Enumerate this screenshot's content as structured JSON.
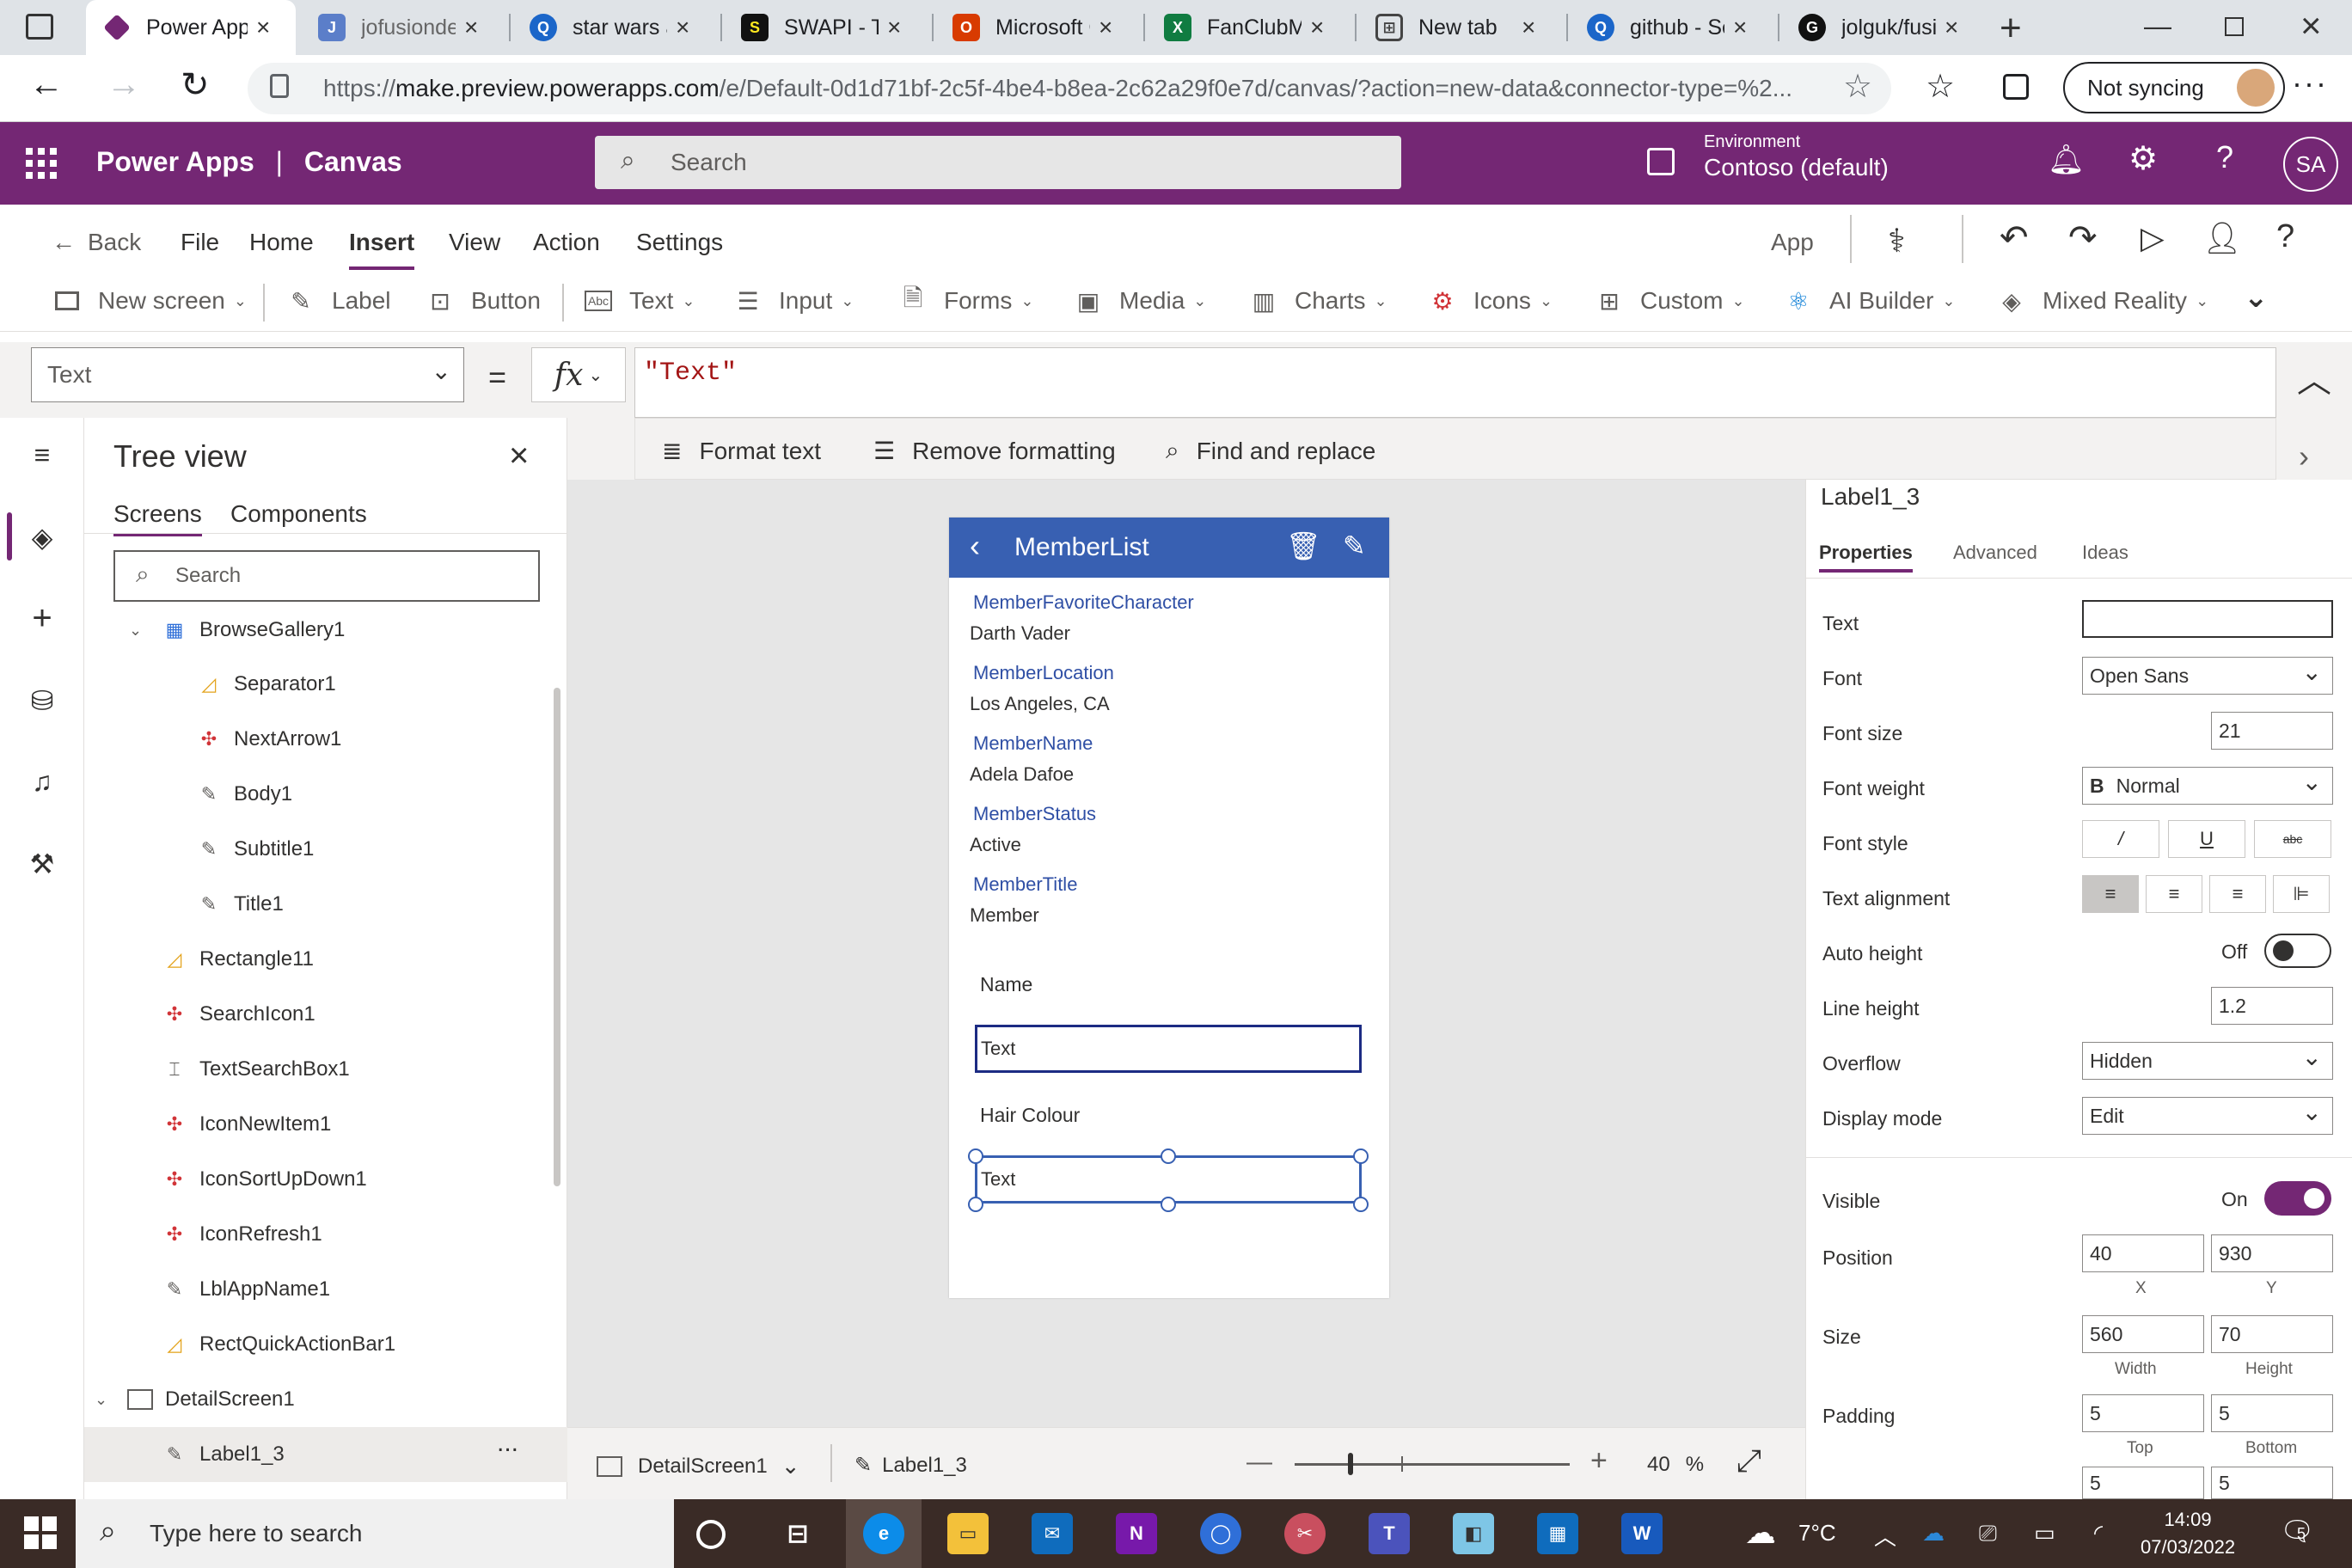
{
  "browser": {
    "tabs": [
      {
        "title": "Power Apps",
        "color": "#742774"
      },
      {
        "title": "jofusionde",
        "color": "#5b7ec9"
      },
      {
        "title": "star wars a",
        "color": "#1b66c9"
      },
      {
        "title": "SWAPI - Th",
        "color": "#111111"
      },
      {
        "title": "Microsoft C",
        "color": "#d83b01"
      },
      {
        "title": "FanClubMe",
        "color": "#107c41"
      },
      {
        "title": "New tab",
        "color": "#444444"
      },
      {
        "title": "github - Se",
        "color": "#1b66c9"
      },
      {
        "title": "jolguk/fusi",
        "color": "#111111"
      }
    ],
    "url_prefix": "https://",
    "url_host": "make.preview.powerapps.com",
    "url_path": "/e/Default-0d1d71bf-2c5f-4be4-b8ea-2c62a29f0e7d/canvas/?action=new-data&connector-type=%2...",
    "sync_label": "Not syncing"
  },
  "header": {
    "app": "Power Apps",
    "section": "Canvas",
    "search_placeholder": "Search",
    "env_label": "Environment",
    "env_name": "Contoso (default)",
    "user_initials": "SA",
    "brand_color": "#742774"
  },
  "menu": {
    "back": "Back",
    "items": [
      "File",
      "Home",
      "Insert",
      "View",
      "Action",
      "Settings"
    ],
    "selected": "Insert",
    "app_label": "App"
  },
  "ribbon": {
    "items": [
      "New screen",
      "Label",
      "Button",
      "Text",
      "Input",
      "Forms",
      "Media",
      "Charts",
      "Icons",
      "Custom",
      "AI Builder",
      "Mixed Reality"
    ]
  },
  "formula": {
    "property": "Text",
    "equals": "=",
    "fx": "fx",
    "expression": "\"Text\"",
    "format_text": "Format text",
    "remove_formatting": "Remove formatting",
    "find_replace": "Find and replace"
  },
  "tree": {
    "title": "Tree view",
    "tabs": [
      "Screens",
      "Components"
    ],
    "search_placeholder": "Search",
    "nodes": [
      {
        "label": "BrowseGallery1",
        "icon": "gallery-icon"
      },
      {
        "label": "Separator1",
        "icon": "shape-icon"
      },
      {
        "label": "NextArrow1",
        "icon": "icons-icon"
      },
      {
        "label": "Body1",
        "icon": "label-icon"
      },
      {
        "label": "Subtitle1",
        "icon": "label-icon"
      },
      {
        "label": "Title1",
        "icon": "label-icon"
      },
      {
        "label": "Rectangle11",
        "icon": "shape-icon"
      },
      {
        "label": "SearchIcon1",
        "icon": "icons-icon"
      },
      {
        "label": "TextSearchBox1",
        "icon": "textinput-icon"
      },
      {
        "label": "IconNewItem1",
        "icon": "icons-icon"
      },
      {
        "label": "IconSortUpDown1",
        "icon": "icons-icon"
      },
      {
        "label": "IconRefresh1",
        "icon": "icons-icon"
      },
      {
        "label": "LblAppName1",
        "icon": "label-icon"
      },
      {
        "label": "RectQuickActionBar1",
        "icon": "shape-icon"
      },
      {
        "label": "DetailScreen1",
        "icon": "screen-icon"
      },
      {
        "label": "Label1_3",
        "icon": "label-icon"
      }
    ],
    "more": "..."
  },
  "app_screen": {
    "title": "MemberList",
    "header_color": "#3860b2",
    "fields": [
      {
        "label": "MemberFavoriteCharacter",
        "value": "Darth Vader"
      },
      {
        "label": "MemberLocation",
        "value": "Los Angeles, CA"
      },
      {
        "label": "MemberName",
        "value": "Adela Dafoe"
      },
      {
        "label": "MemberStatus",
        "value": "Active"
      },
      {
        "label": "MemberTitle",
        "value": "Member"
      }
    ],
    "form": [
      {
        "label": "Name",
        "input": "Text"
      },
      {
        "label": "Hair Colour",
        "input": "Text"
      }
    ]
  },
  "statusbar": {
    "screen": "DetailScreen1",
    "control": "Label1_3",
    "zoom": "40",
    "zoom_unit": "%"
  },
  "properties": {
    "control_name": "Label1_3",
    "tabs": [
      "Properties",
      "Advanced",
      "Ideas"
    ],
    "text_label": "Text",
    "text_value": "",
    "font_label": "Font",
    "font_value": "Open Sans",
    "font_size_label": "Font size",
    "font_size_value": "21",
    "font_weight_label": "Font weight",
    "font_weight_prefix": "B",
    "font_weight_value": "Normal",
    "font_style_label": "Font style",
    "font_style_buttons": [
      "/",
      "U",
      "abc"
    ],
    "text_alignment_label": "Text alignment",
    "auto_height_label": "Auto height",
    "auto_height_state": "Off",
    "line_height_label": "Line height",
    "line_height_value": "1.2",
    "overflow_label": "Overflow",
    "overflow_value": "Hidden",
    "display_mode_label": "Display mode",
    "display_mode_value": "Edit",
    "visible_label": "Visible",
    "visible_state": "On",
    "position_label": "Position",
    "position_x": "40",
    "position_y": "930",
    "x_label": "X",
    "y_label": "Y",
    "size_label": "Size",
    "width": "560",
    "height": "70",
    "width_label": "Width",
    "height_label": "Height",
    "padding_label": "Padding",
    "padding_top": "5",
    "padding_bottom": "5",
    "padding_left": "5",
    "padding_right": "5",
    "top_label": "Top",
    "bottom_label": "Bottom"
  },
  "taskbar": {
    "search_placeholder": "Type here to search",
    "weather": "7°C",
    "time": "14:09",
    "date": "07/03/2022",
    "notifications": "5"
  }
}
